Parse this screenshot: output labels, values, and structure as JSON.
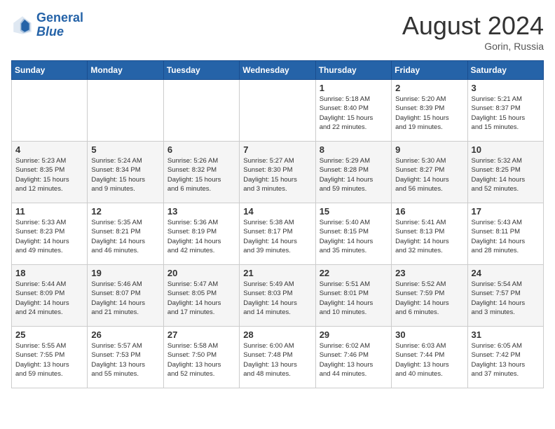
{
  "header": {
    "logo_line1": "General",
    "logo_line2": "Blue",
    "month_year": "August 2024",
    "location": "Gorin, Russia"
  },
  "days_of_week": [
    "Sunday",
    "Monday",
    "Tuesday",
    "Wednesday",
    "Thursday",
    "Friday",
    "Saturday"
  ],
  "weeks": [
    [
      {
        "day": "",
        "info": ""
      },
      {
        "day": "",
        "info": ""
      },
      {
        "day": "",
        "info": ""
      },
      {
        "day": "",
        "info": ""
      },
      {
        "day": "1",
        "info": "Sunrise: 5:18 AM\nSunset: 8:40 PM\nDaylight: 15 hours\nand 22 minutes."
      },
      {
        "day": "2",
        "info": "Sunrise: 5:20 AM\nSunset: 8:39 PM\nDaylight: 15 hours\nand 19 minutes."
      },
      {
        "day": "3",
        "info": "Sunrise: 5:21 AM\nSunset: 8:37 PM\nDaylight: 15 hours\nand 15 minutes."
      }
    ],
    [
      {
        "day": "4",
        "info": "Sunrise: 5:23 AM\nSunset: 8:35 PM\nDaylight: 15 hours\nand 12 minutes."
      },
      {
        "day": "5",
        "info": "Sunrise: 5:24 AM\nSunset: 8:34 PM\nDaylight: 15 hours\nand 9 minutes."
      },
      {
        "day": "6",
        "info": "Sunrise: 5:26 AM\nSunset: 8:32 PM\nDaylight: 15 hours\nand 6 minutes."
      },
      {
        "day": "7",
        "info": "Sunrise: 5:27 AM\nSunset: 8:30 PM\nDaylight: 15 hours\nand 3 minutes."
      },
      {
        "day": "8",
        "info": "Sunrise: 5:29 AM\nSunset: 8:28 PM\nDaylight: 14 hours\nand 59 minutes."
      },
      {
        "day": "9",
        "info": "Sunrise: 5:30 AM\nSunset: 8:27 PM\nDaylight: 14 hours\nand 56 minutes."
      },
      {
        "day": "10",
        "info": "Sunrise: 5:32 AM\nSunset: 8:25 PM\nDaylight: 14 hours\nand 52 minutes."
      }
    ],
    [
      {
        "day": "11",
        "info": "Sunrise: 5:33 AM\nSunset: 8:23 PM\nDaylight: 14 hours\nand 49 minutes."
      },
      {
        "day": "12",
        "info": "Sunrise: 5:35 AM\nSunset: 8:21 PM\nDaylight: 14 hours\nand 46 minutes."
      },
      {
        "day": "13",
        "info": "Sunrise: 5:36 AM\nSunset: 8:19 PM\nDaylight: 14 hours\nand 42 minutes."
      },
      {
        "day": "14",
        "info": "Sunrise: 5:38 AM\nSunset: 8:17 PM\nDaylight: 14 hours\nand 39 minutes."
      },
      {
        "day": "15",
        "info": "Sunrise: 5:40 AM\nSunset: 8:15 PM\nDaylight: 14 hours\nand 35 minutes."
      },
      {
        "day": "16",
        "info": "Sunrise: 5:41 AM\nSunset: 8:13 PM\nDaylight: 14 hours\nand 32 minutes."
      },
      {
        "day": "17",
        "info": "Sunrise: 5:43 AM\nSunset: 8:11 PM\nDaylight: 14 hours\nand 28 minutes."
      }
    ],
    [
      {
        "day": "18",
        "info": "Sunrise: 5:44 AM\nSunset: 8:09 PM\nDaylight: 14 hours\nand 24 minutes."
      },
      {
        "day": "19",
        "info": "Sunrise: 5:46 AM\nSunset: 8:07 PM\nDaylight: 14 hours\nand 21 minutes."
      },
      {
        "day": "20",
        "info": "Sunrise: 5:47 AM\nSunset: 8:05 PM\nDaylight: 14 hours\nand 17 minutes."
      },
      {
        "day": "21",
        "info": "Sunrise: 5:49 AM\nSunset: 8:03 PM\nDaylight: 14 hours\nand 14 minutes."
      },
      {
        "day": "22",
        "info": "Sunrise: 5:51 AM\nSunset: 8:01 PM\nDaylight: 14 hours\nand 10 minutes."
      },
      {
        "day": "23",
        "info": "Sunrise: 5:52 AM\nSunset: 7:59 PM\nDaylight: 14 hours\nand 6 minutes."
      },
      {
        "day": "24",
        "info": "Sunrise: 5:54 AM\nSunset: 7:57 PM\nDaylight: 14 hours\nand 3 minutes."
      }
    ],
    [
      {
        "day": "25",
        "info": "Sunrise: 5:55 AM\nSunset: 7:55 PM\nDaylight: 13 hours\nand 59 minutes."
      },
      {
        "day": "26",
        "info": "Sunrise: 5:57 AM\nSunset: 7:53 PM\nDaylight: 13 hours\nand 55 minutes."
      },
      {
        "day": "27",
        "info": "Sunrise: 5:58 AM\nSunset: 7:50 PM\nDaylight: 13 hours\nand 52 minutes."
      },
      {
        "day": "28",
        "info": "Sunrise: 6:00 AM\nSunset: 7:48 PM\nDaylight: 13 hours\nand 48 minutes."
      },
      {
        "day": "29",
        "info": "Sunrise: 6:02 AM\nSunset: 7:46 PM\nDaylight: 13 hours\nand 44 minutes."
      },
      {
        "day": "30",
        "info": "Sunrise: 6:03 AM\nSunset: 7:44 PM\nDaylight: 13 hours\nand 40 minutes."
      },
      {
        "day": "31",
        "info": "Sunrise: 6:05 AM\nSunset: 7:42 PM\nDaylight: 13 hours\nand 37 minutes."
      }
    ]
  ]
}
